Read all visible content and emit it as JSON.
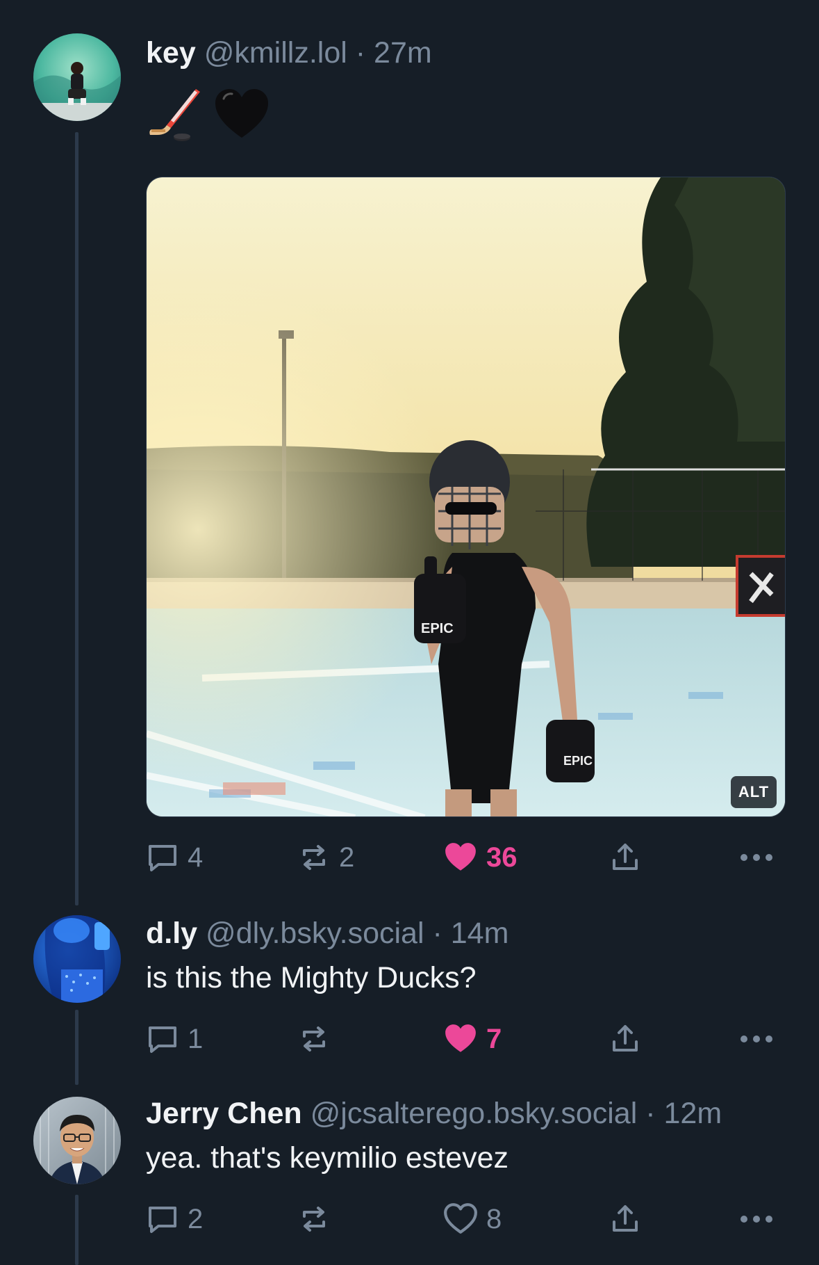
{
  "posts": [
    {
      "display_name": "key",
      "handle": "@kmillz.lol",
      "time": "27m",
      "emojis": [
        "hockey-stick-icon",
        "black-heart-icon"
      ],
      "image_alt_badge": "ALT",
      "replies": "4",
      "reposts": "2",
      "likes": "36",
      "liked": true
    },
    {
      "display_name": "d.ly",
      "handle": "@dly.bsky.social",
      "time": "14m",
      "text": "is this the Mighty Ducks?",
      "replies": "1",
      "reposts": "",
      "likes": "7",
      "liked": true
    },
    {
      "display_name": "Jerry Chen",
      "handle": "@jcsalterego.bsky.social",
      "time": "12m",
      "text": "yea. that's keymilio estevez",
      "replies": "2",
      "reposts": "",
      "likes": "8",
      "liked": false
    }
  ],
  "separator": "·",
  "colors": {
    "background": "#161e27",
    "muted": "#7b8a9c",
    "like_pink": "#ec4899",
    "thread_line": "#2c3a4b"
  }
}
